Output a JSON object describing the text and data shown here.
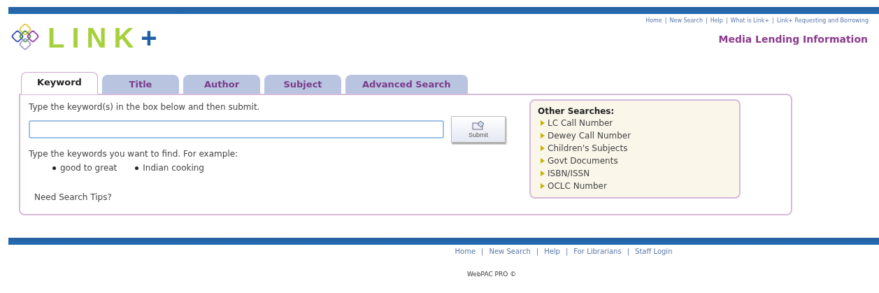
{
  "header": {
    "logo_text": "LINK",
    "logo_plus": "+",
    "links": [
      "Home",
      "New Search",
      "Help",
      "What is Link+",
      "Link+ Requesting and Borrowing"
    ],
    "separator": "|",
    "page_title": "Media Lending Information"
  },
  "tabs": [
    {
      "label": "Keyword",
      "selected": true
    },
    {
      "label": "Title",
      "selected": false
    },
    {
      "label": "Author",
      "selected": false
    },
    {
      "label": "Subject",
      "selected": false
    },
    {
      "label": "Advanced Search",
      "selected": false
    }
  ],
  "search": {
    "instruction": "Type the keyword(s) in the box below and then submit.",
    "submit_label": "Submit",
    "hint": "Type the keywords you want to find. For example:",
    "examples": [
      "good to great",
      "Indian cooking"
    ],
    "tips_link": "Need Search Tips?"
  },
  "other_searches": {
    "title": "Other Searches:",
    "items": [
      "LC Call Number",
      "Dewey Call Number",
      "Children's Subjects",
      "Govt Documents",
      "ISBN/ISSN",
      "OCLC Number"
    ]
  },
  "footer": {
    "links": [
      "Home",
      "New Search",
      "Help",
      "For Librarians",
      "Staff Login"
    ],
    "separator": "|",
    "credit": "WebPAC PRO ©"
  }
}
